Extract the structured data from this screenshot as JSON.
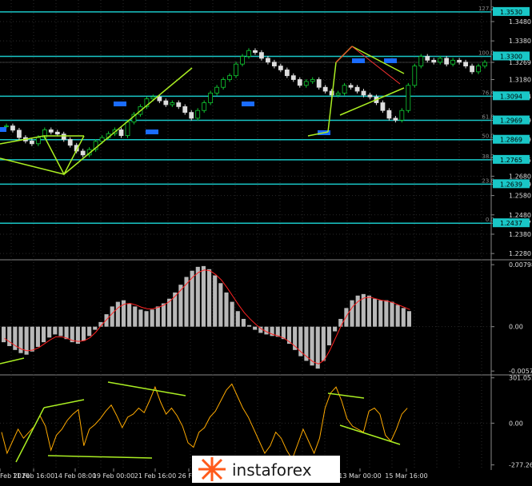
{
  "chart_data": [
    {
      "type": "line",
      "subtype": "candlestick",
      "title": "",
      "y_ticks": [
        "1.3480",
        "1.3380",
        "1.3269",
        "1.3180",
        "1.3094",
        "1.2969",
        "1.2869",
        "1.2765",
        "1.2680",
        "1.2639",
        "1.2580",
        "1.2480",
        "1.2437",
        "1.2380",
        "1.2280"
      ],
      "ylim": [
        1.226,
        1.3575
      ],
      "fib_levels": [
        {
          "label": "127.2",
          "price": "1.3530",
          "value": 1.353,
          "highlight": true
        },
        {
          "label": "100.0",
          "price": "1.3300",
          "value": 1.33,
          "highlight": true
        },
        {
          "label": "76.4",
          "price": "1.3094",
          "value": 1.3094,
          "highlight": true
        },
        {
          "label": "61.8",
          "price": "1.2969",
          "value": 1.2969,
          "highlight": true
        },
        {
          "label": "50.0",
          "price": "1.2869",
          "value": 1.2869,
          "highlight": true
        },
        {
          "label": "38.2",
          "price": "1.2765",
          "value": 1.2765,
          "highlight": true
        },
        {
          "label": "23.6",
          "price": "1.2639",
          "value": 1.2639,
          "highlight": true
        },
        {
          "label": "0.0",
          "price": "1.2437",
          "value": 1.2437,
          "highlight": true
        }
      ],
      "current_price": "1.3269",
      "series": [
        {
          "values": [
            1.294,
            1.2918,
            1.288,
            1.2862,
            1.2848,
            1.288,
            1.292,
            1.2908,
            1.2898,
            1.287,
            1.284,
            1.281,
            1.279,
            1.2818,
            1.286,
            1.288,
            1.29,
            1.292,
            1.289,
            1.296,
            1.3,
            1.304,
            1.308,
            1.309,
            1.307,
            1.305,
            1.306,
            1.304,
            1.301,
            1.298,
            1.302,
            1.306,
            1.311,
            1.314,
            1.318,
            1.32,
            1.326,
            1.33,
            1.333,
            1.332,
            1.329,
            1.327,
            1.325,
            1.323,
            1.32,
            1.318,
            1.315,
            1.317,
            1.318,
            1.314,
            1.312,
            1.31,
            1.311,
            1.315,
            1.314,
            1.312,
            1.31,
            1.309,
            1.306,
            1.302,
            1.298,
            1.297,
            1.302,
            1.315,
            1.325,
            1.33,
            1.328,
            1.327,
            1.329,
            1.326,
            1.328,
            1.327,
            1.325,
            1.322,
            1.325,
            1.3269
          ]
        }
      ]
    },
    {
      "type": "bar",
      "y_ticks": [
        "0.00798",
        "0.00",
        "-0.00571"
      ],
      "ylim": [
        -0.006,
        0.0083
      ],
      "series": [
        {
          "values": [
            -0.002,
            -0.0025,
            -0.003,
            -0.0034,
            -0.0036,
            -0.0032,
            -0.0026,
            -0.002,
            -0.0014,
            -0.001,
            -0.0012,
            -0.0016,
            -0.002,
            -0.0022,
            -0.0018,
            -0.0012,
            -0.0004,
            0.0006,
            0.0016,
            0.0026,
            0.0032,
            0.0034,
            0.003,
            0.0026,
            0.0022,
            0.002,
            0.0022,
            0.0026,
            0.003,
            0.0036,
            0.0044,
            0.0054,
            0.0064,
            0.0072,
            0.0077,
            0.0078,
            0.0074,
            0.0066,
            0.0056,
            0.0044,
            0.0032,
            0.002,
            0.001,
            0.0002,
            -0.0004,
            -0.0008,
            -0.001,
            -0.0012,
            -0.0013,
            -0.0016,
            -0.0022,
            -0.003,
            -0.0038,
            -0.0044,
            -0.005,
            -0.0054,
            -0.0044,
            -0.0024,
            -0.0006,
            0.001,
            0.0024,
            0.0034,
            0.004,
            0.0042,
            0.004,
            0.0036,
            0.0034,
            0.0034,
            0.0032,
            0.0028,
            0.0024,
            0.002
          ]
        },
        {
          "values": [
            -0.0015,
            -0.002,
            -0.0025,
            -0.0029,
            -0.0031,
            -0.003,
            -0.0027,
            -0.0022,
            -0.0017,
            -0.0013,
            -0.0013,
            -0.0015,
            -0.0018,
            -0.0019,
            -0.0018,
            -0.0014,
            -0.0007,
            0.0002,
            0.001,
            0.0018,
            0.0025,
            0.0029,
            0.003,
            0.0028,
            0.0025,
            0.0023,
            0.0023,
            0.0025,
            0.0028,
            0.0033,
            0.004,
            0.0048,
            0.0056,
            0.0064,
            0.007,
            0.0073,
            0.0072,
            0.0067,
            0.006,
            0.005,
            0.0039,
            0.0028,
            0.0018,
            0.001,
            0.0003,
            -0.0003,
            -0.0007,
            -0.001,
            -0.0012,
            -0.0015,
            -0.002,
            -0.0026,
            -0.0033,
            -0.0039,
            -0.0045,
            -0.0048,
            -0.0043,
            -0.003,
            -0.0014,
            0.0002,
            0.0015,
            0.0026,
            0.0033,
            0.0037,
            0.0038,
            0.0036,
            0.0034,
            0.0033,
            0.0031,
            0.0028,
            0.0025,
            0.0022
          ]
        }
      ]
    },
    {
      "type": "line",
      "y_ticks": [
        "301.0559",
        "0.00",
        "-277.2674"
      ],
      "ylim": [
        -290,
        310
      ],
      "series": [
        {
          "values": [
            -60,
            -200,
            -120,
            -40,
            -100,
            -60,
            -20,
            50,
            -20,
            -180,
            -80,
            -40,
            20,
            60,
            90,
            -150,
            -40,
            -10,
            30,
            80,
            120,
            50,
            -30,
            40,
            60,
            100,
            70,
            150,
            240,
            140,
            60,
            100,
            50,
            -20,
            -130,
            -160,
            -60,
            -30,
            40,
            80,
            150,
            220,
            260,
            180,
            100,
            40,
            -40,
            -120,
            -200,
            -150,
            -60,
            -100,
            -180,
            -240,
            -140,
            -40,
            -120,
            -200,
            -100,
            100,
            200,
            240,
            150,
            30,
            -20,
            -40,
            -60,
            80,
            100,
            60,
            -80,
            -120,
            -40,
            60,
            100
          ]
        }
      ]
    }
  ],
  "x_ticks": [
    "Feb 2020",
    "11 Feb 16:00",
    "14 Feb 08:00",
    "19 Feb 00:00",
    "21 Feb 16:00",
    "26 Feb",
    "13 Mar 00:00",
    "15 Mar 16:00"
  ],
  "watermark": "instaforex",
  "colors": {
    "background": "#000000",
    "grid": "#2a2a2a",
    "fib": "#19c7c7",
    "trend": "#aaee22",
    "bull": "#11cc33",
    "bear": "#dddddd",
    "osma": "#b8b8b8",
    "signal": "#ff2222",
    "cci": "#ffaa00",
    "highlight_box": "#1a6cff"
  }
}
